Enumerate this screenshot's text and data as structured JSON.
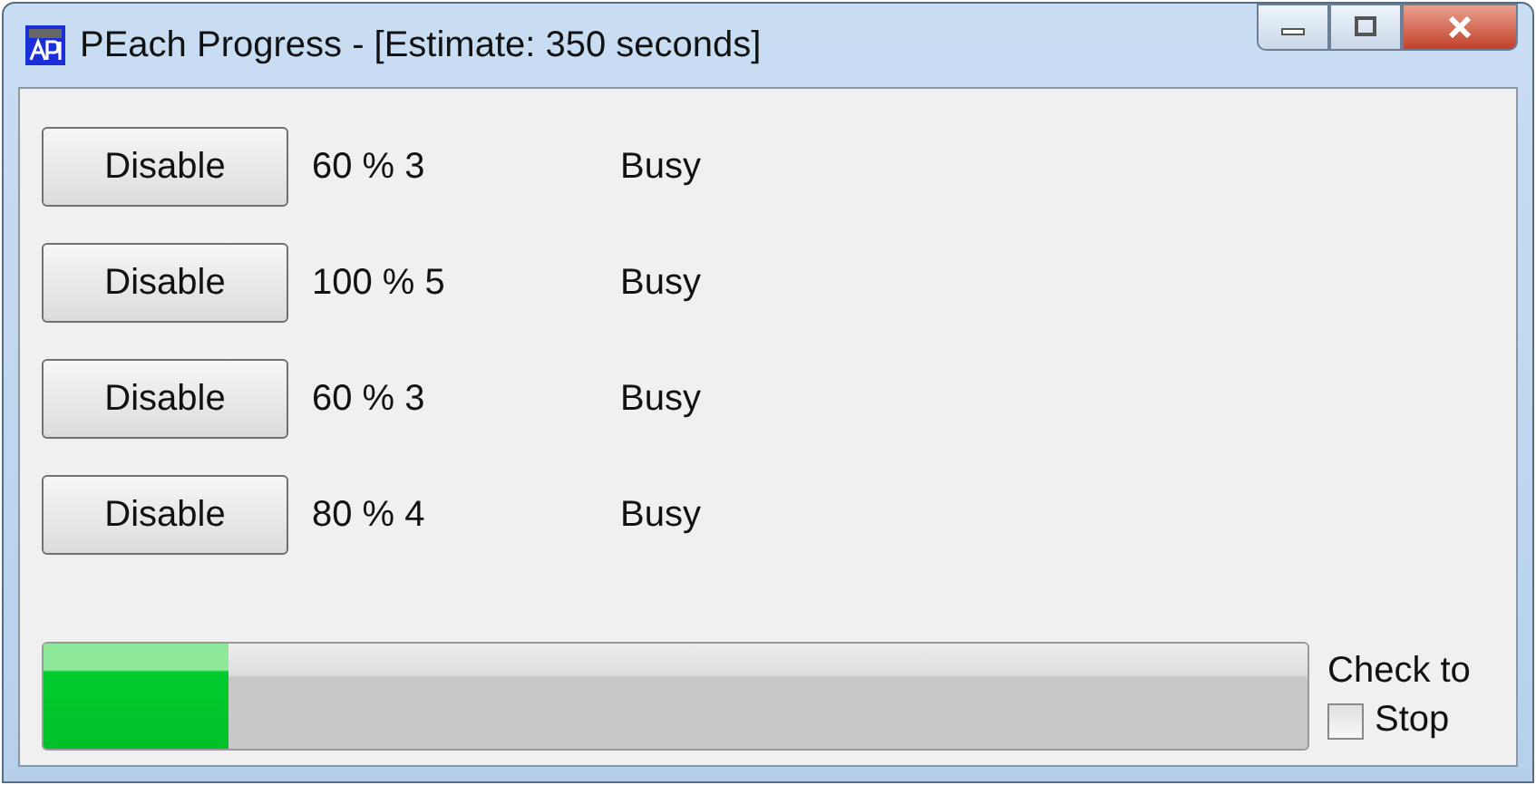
{
  "window": {
    "title": "PEach Progress - [Estimate: 350 seconds]"
  },
  "rows": [
    {
      "button": "Disable",
      "progress": "60 % 3",
      "status": "Busy"
    },
    {
      "button": "Disable",
      "progress": "100 % 5",
      "status": "Busy"
    },
    {
      "button": "Disable",
      "progress": "60 % 3",
      "status": "Busy"
    },
    {
      "button": "Disable",
      "progress": "80 % 4",
      "status": "Busy"
    }
  ],
  "progress_bar": {
    "level": 0.146
  },
  "stop": {
    "label_line1": "Check to",
    "label_line2": "Stop",
    "checked": false
  }
}
